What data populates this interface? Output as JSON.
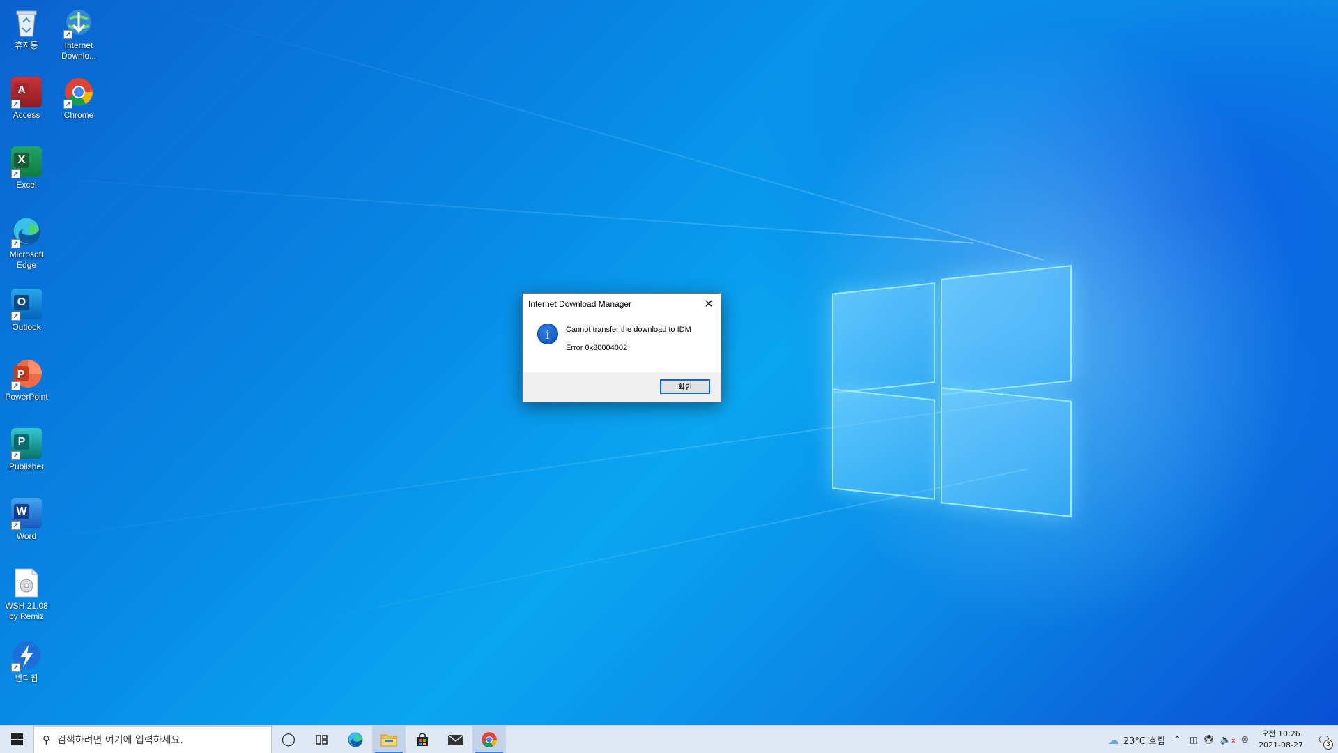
{
  "desktop": {
    "icons": [
      {
        "label": "휴지통",
        "icon": "recycle-bin-icon"
      },
      {
        "label": "Internet Downlo...",
        "icon": "idm-icon"
      },
      {
        "label": "Access",
        "icon": "access-icon"
      },
      {
        "label": "Chrome",
        "icon": "chrome-icon"
      },
      {
        "label": "Excel",
        "icon": "excel-icon"
      },
      {
        "label": "Microsoft Edge",
        "icon": "edge-icon"
      },
      {
        "label": "Outlook",
        "icon": "outlook-icon"
      },
      {
        "label": "PowerPoint",
        "icon": "powerpoint-icon"
      },
      {
        "label": "Publisher",
        "icon": "publisher-icon"
      },
      {
        "label": "Word",
        "icon": "word-icon"
      },
      {
        "label": "WSH 21.08 by Remiz",
        "icon": "wsh-file-icon"
      },
      {
        "label": "반디집",
        "icon": "bandizip-icon"
      }
    ]
  },
  "dialog": {
    "title": "Internet Download Manager",
    "message": "Cannot transfer the download to IDM",
    "error": "Error 0x80004002",
    "ok_label": "확인",
    "icon": "info-icon"
  },
  "taskbar": {
    "search_placeholder": "검색하려면 여기에 입력하세요.",
    "weather": "23°C  흐림",
    "time": "오전 10:26",
    "date": "2021-08-27",
    "notification_count": "3",
    "apps": [
      "cortana-icon",
      "task-view-icon",
      "edge-icon",
      "file-explorer-icon",
      "store-icon",
      "mail-icon",
      "chrome-icon"
    ]
  },
  "colors": {
    "accent": "#0a64d8",
    "taskbar_bg": "#dfe9f5",
    "wallpaper_blue": "#0a86e6"
  }
}
